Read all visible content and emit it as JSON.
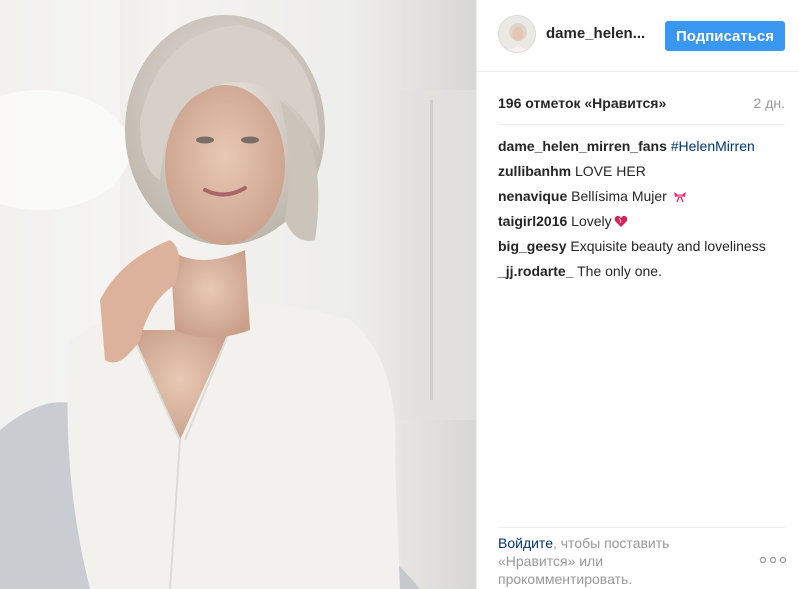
{
  "post": {
    "username": "dame_helen...",
    "follow_label": "Подписаться",
    "likes_text": "196 отметок «Нравится»",
    "time_ago": "2 дн."
  },
  "comments": [
    {
      "user": "dame_helen_mirren_fans",
      "text": "",
      "tag": "#HelenMirren"
    },
    {
      "user": "zullibanhm",
      "text": "LOVE HER",
      "tag": ""
    },
    {
      "user": "nenavique",
      "text": "Bellísima Mujer",
      "tag": "",
      "emoji": "ribbon-emoji"
    },
    {
      "user": "taigirl2016",
      "text": "Lovely",
      "tag": "",
      "emoji": "heart-emoji"
    },
    {
      "user": "big_geesy",
      "text": "Exquisite beauty and loveliness",
      "tag": ""
    },
    {
      "user": "_jj.rodarte_",
      "text": "The only one.",
      "tag": ""
    }
  ],
  "footer": {
    "login_link": "Войдите",
    "login_text": ", чтобы поставить «Нравится» или прокомментировать."
  },
  "colors": {
    "follow_button": "#3897f0",
    "link": "#003569",
    "muted": "#999999",
    "emoji_ribbon": "#e0307a",
    "emoji_heart": "#d6235a"
  }
}
